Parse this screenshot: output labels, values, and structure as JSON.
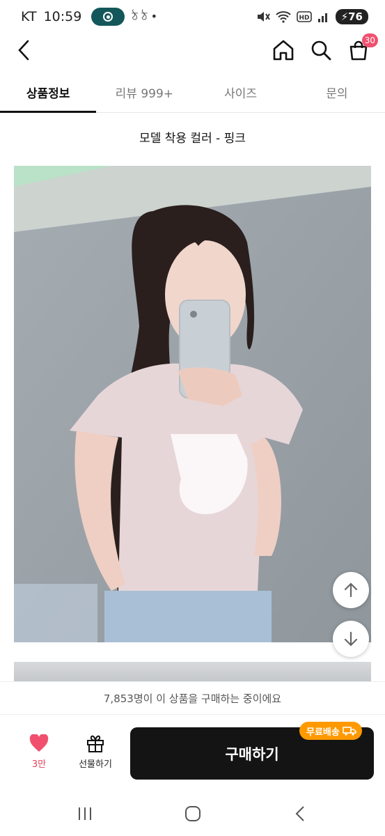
{
  "status_bar": {
    "carrier": "KT",
    "time": "10:59",
    "notif_icons": "ঠ ঠ •",
    "battery": "76"
  },
  "header": {
    "cart_count": "30"
  },
  "tabs": [
    {
      "label": "상품정보"
    },
    {
      "label": "리뷰 999+"
    },
    {
      "label": "사이즈"
    },
    {
      "label": "문의"
    }
  ],
  "content": {
    "caption": "모델 착용 컬러 - 핑크"
  },
  "notice": {
    "text": "7,853명이 이 상품을 구매하는 중이에요"
  },
  "bottom_bar": {
    "like_count": "3만",
    "gift_label": "선물하기",
    "buy_label": "구매하기",
    "shipping_badge": "무료배송"
  },
  "colors": {
    "accent": "#f0506e",
    "buy_button": "#141414",
    "shipping_badge": "#ff9900",
    "like": "#e6405a"
  }
}
